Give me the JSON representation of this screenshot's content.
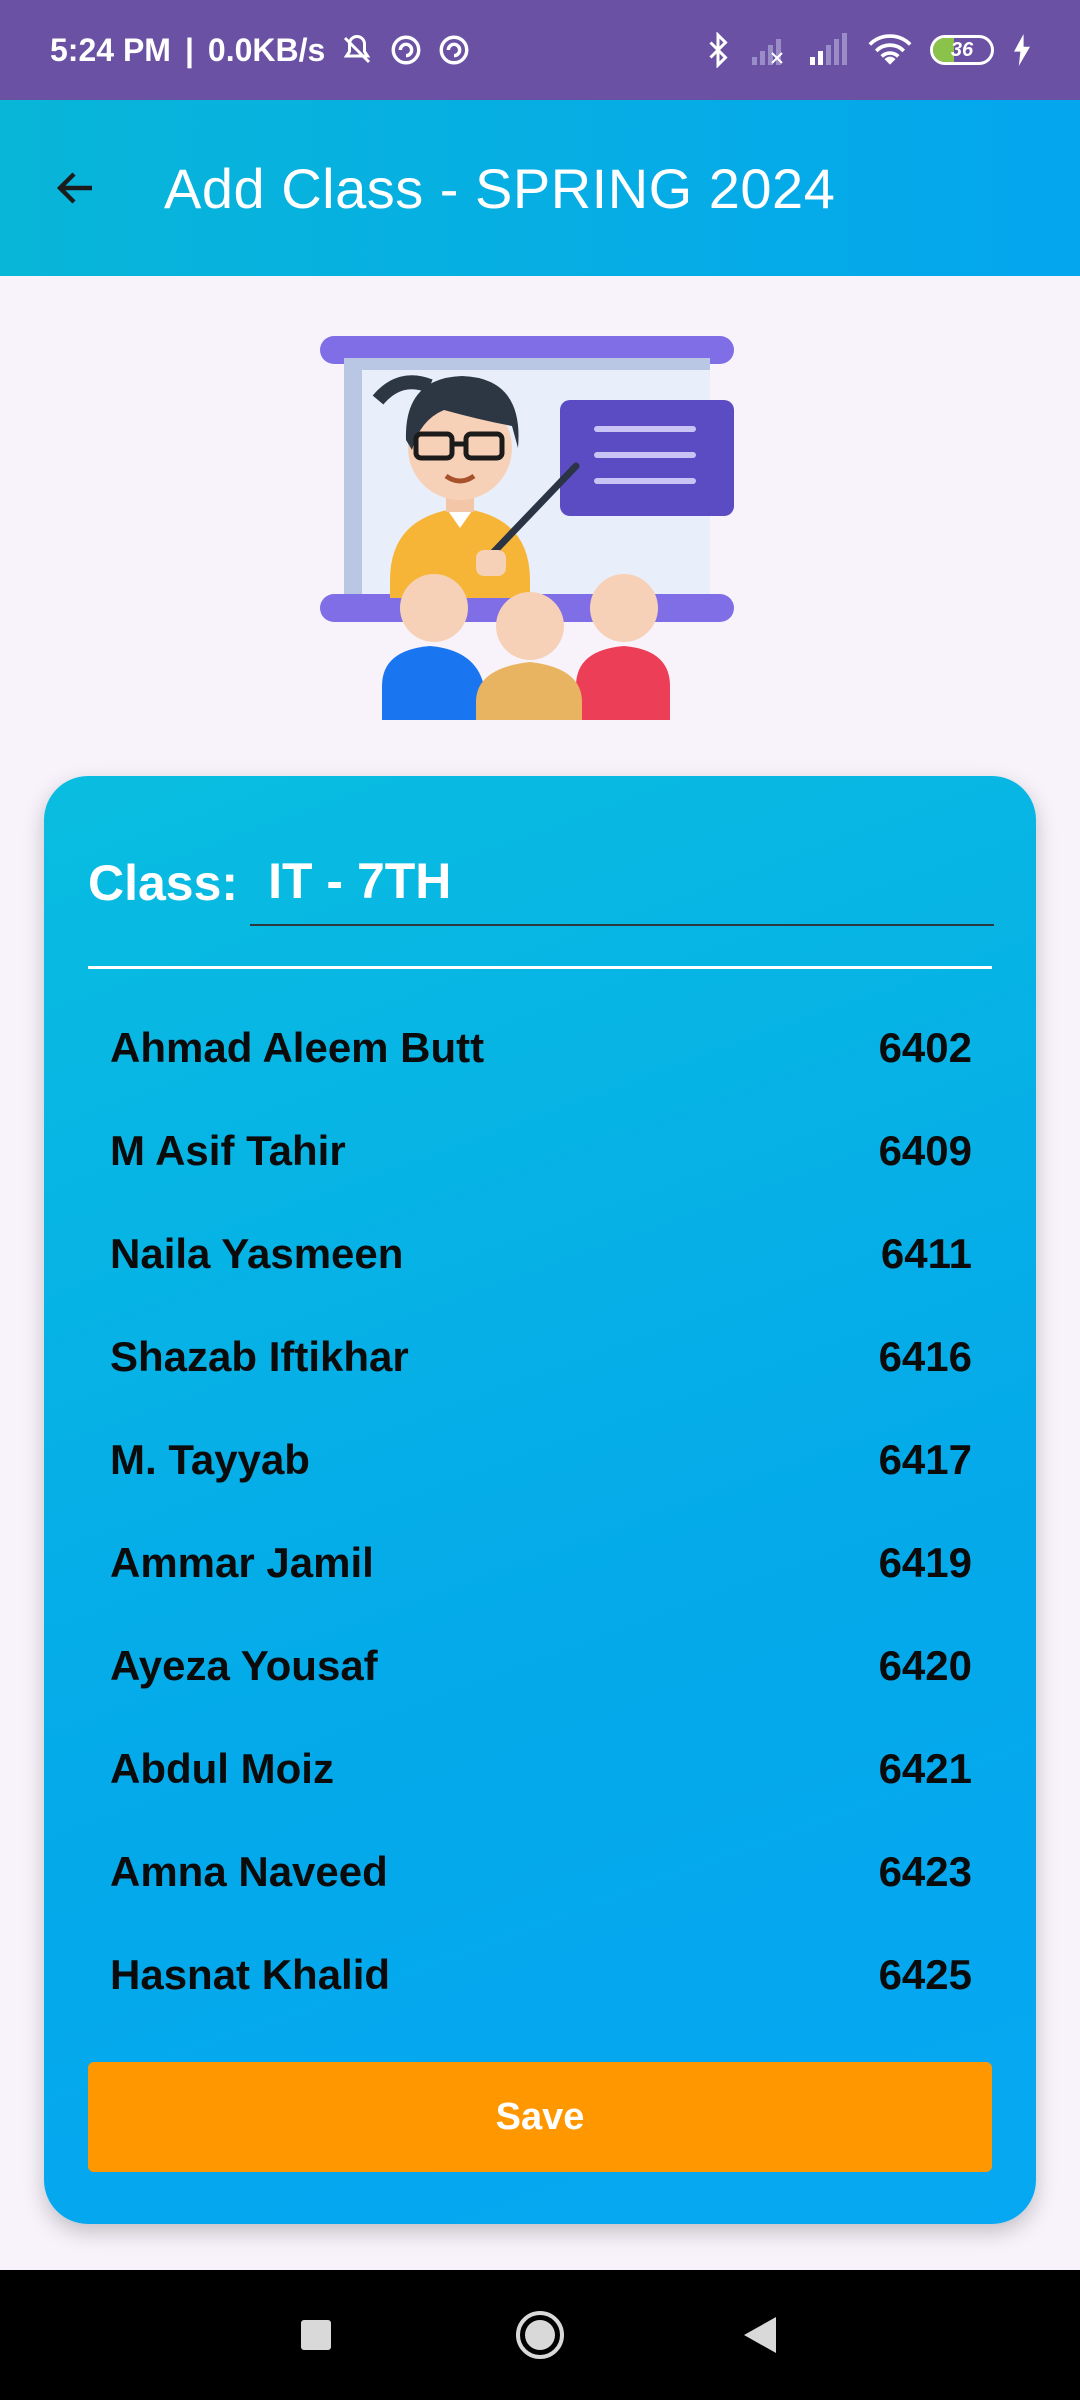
{
  "status_bar": {
    "time": "5:24 PM",
    "net_speed": "0.0KB/s",
    "battery_level": "36",
    "battery_fraction": 0.36
  },
  "app_bar": {
    "title": "Add Class - SPRING 2024",
    "back_icon": "arrow-left-icon"
  },
  "form": {
    "class_label": "Class:",
    "class_value": "IT - 7TH"
  },
  "students": [
    {
      "name": "Ahmad Aleem Butt",
      "id": "6402"
    },
    {
      "name": "M Asif Tahir",
      "id": "6409"
    },
    {
      "name": "Naila Yasmeen",
      "id": "6411"
    },
    {
      "name": "Shazab Iftikhar",
      "id": "6416"
    },
    {
      "name": "M. Tayyab",
      "id": "6417"
    },
    {
      "name": "Ammar Jamil",
      "id": "6419"
    },
    {
      "name": "Ayeza Yousaf",
      "id": "6420"
    },
    {
      "name": "Abdul Moiz",
      "id": "6421"
    },
    {
      "name": "Amna Naveed",
      "id": "6423"
    },
    {
      "name": "Hasnat Khalid",
      "id": "6425"
    }
  ],
  "actions": {
    "save_label": "Save"
  },
  "colors": {
    "status_bar": "#6a51a3",
    "app_bar_start": "#08b6d8",
    "app_bar_end": "#04a6ee",
    "save_button": "#ff9800"
  }
}
